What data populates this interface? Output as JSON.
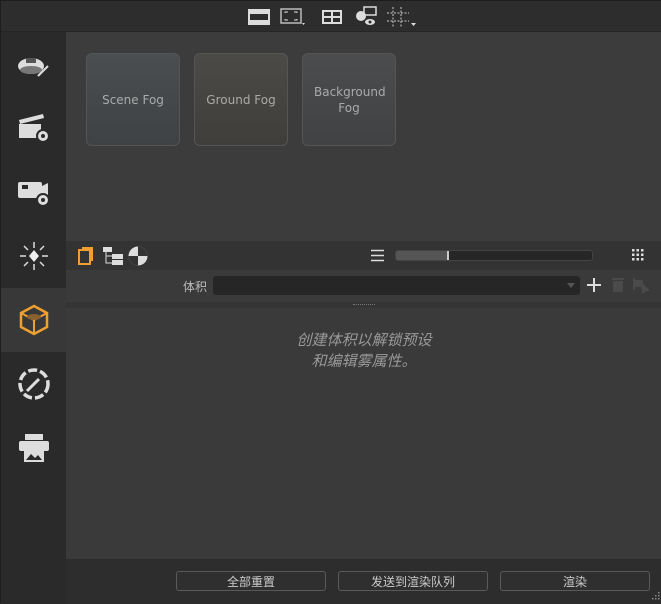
{
  "toolbar": {
    "icons": [
      "viewport-icon",
      "frame-icon",
      "layout-icon",
      "visibility-icon",
      "grid-icon"
    ]
  },
  "sidebar": {
    "items": [
      {
        "icon": "car-wand-icon"
      },
      {
        "icon": "scene-settings-icon"
      },
      {
        "icon": "camera-settings-icon"
      },
      {
        "icon": "light-icon"
      },
      {
        "icon": "volume-box-icon",
        "active": true
      },
      {
        "icon": "color-picker-icon"
      },
      {
        "icon": "print-render-icon"
      }
    ]
  },
  "presets": [
    {
      "label": "Scene Fog"
    },
    {
      "label": "Ground Fog"
    },
    {
      "label": "Background Fog"
    }
  ],
  "panel": {
    "slider_value": 0.27,
    "volume_label": "体积",
    "volume_value": "",
    "empty_message_line1": "创建体积以解锁预设",
    "empty_message_line2": "和编辑雾属性。"
  },
  "footer": {
    "reset_all": "全部重置",
    "send_to_queue": "发送到渲染队列",
    "render": "渲染"
  },
  "colors": {
    "accent": "#f0a030"
  }
}
